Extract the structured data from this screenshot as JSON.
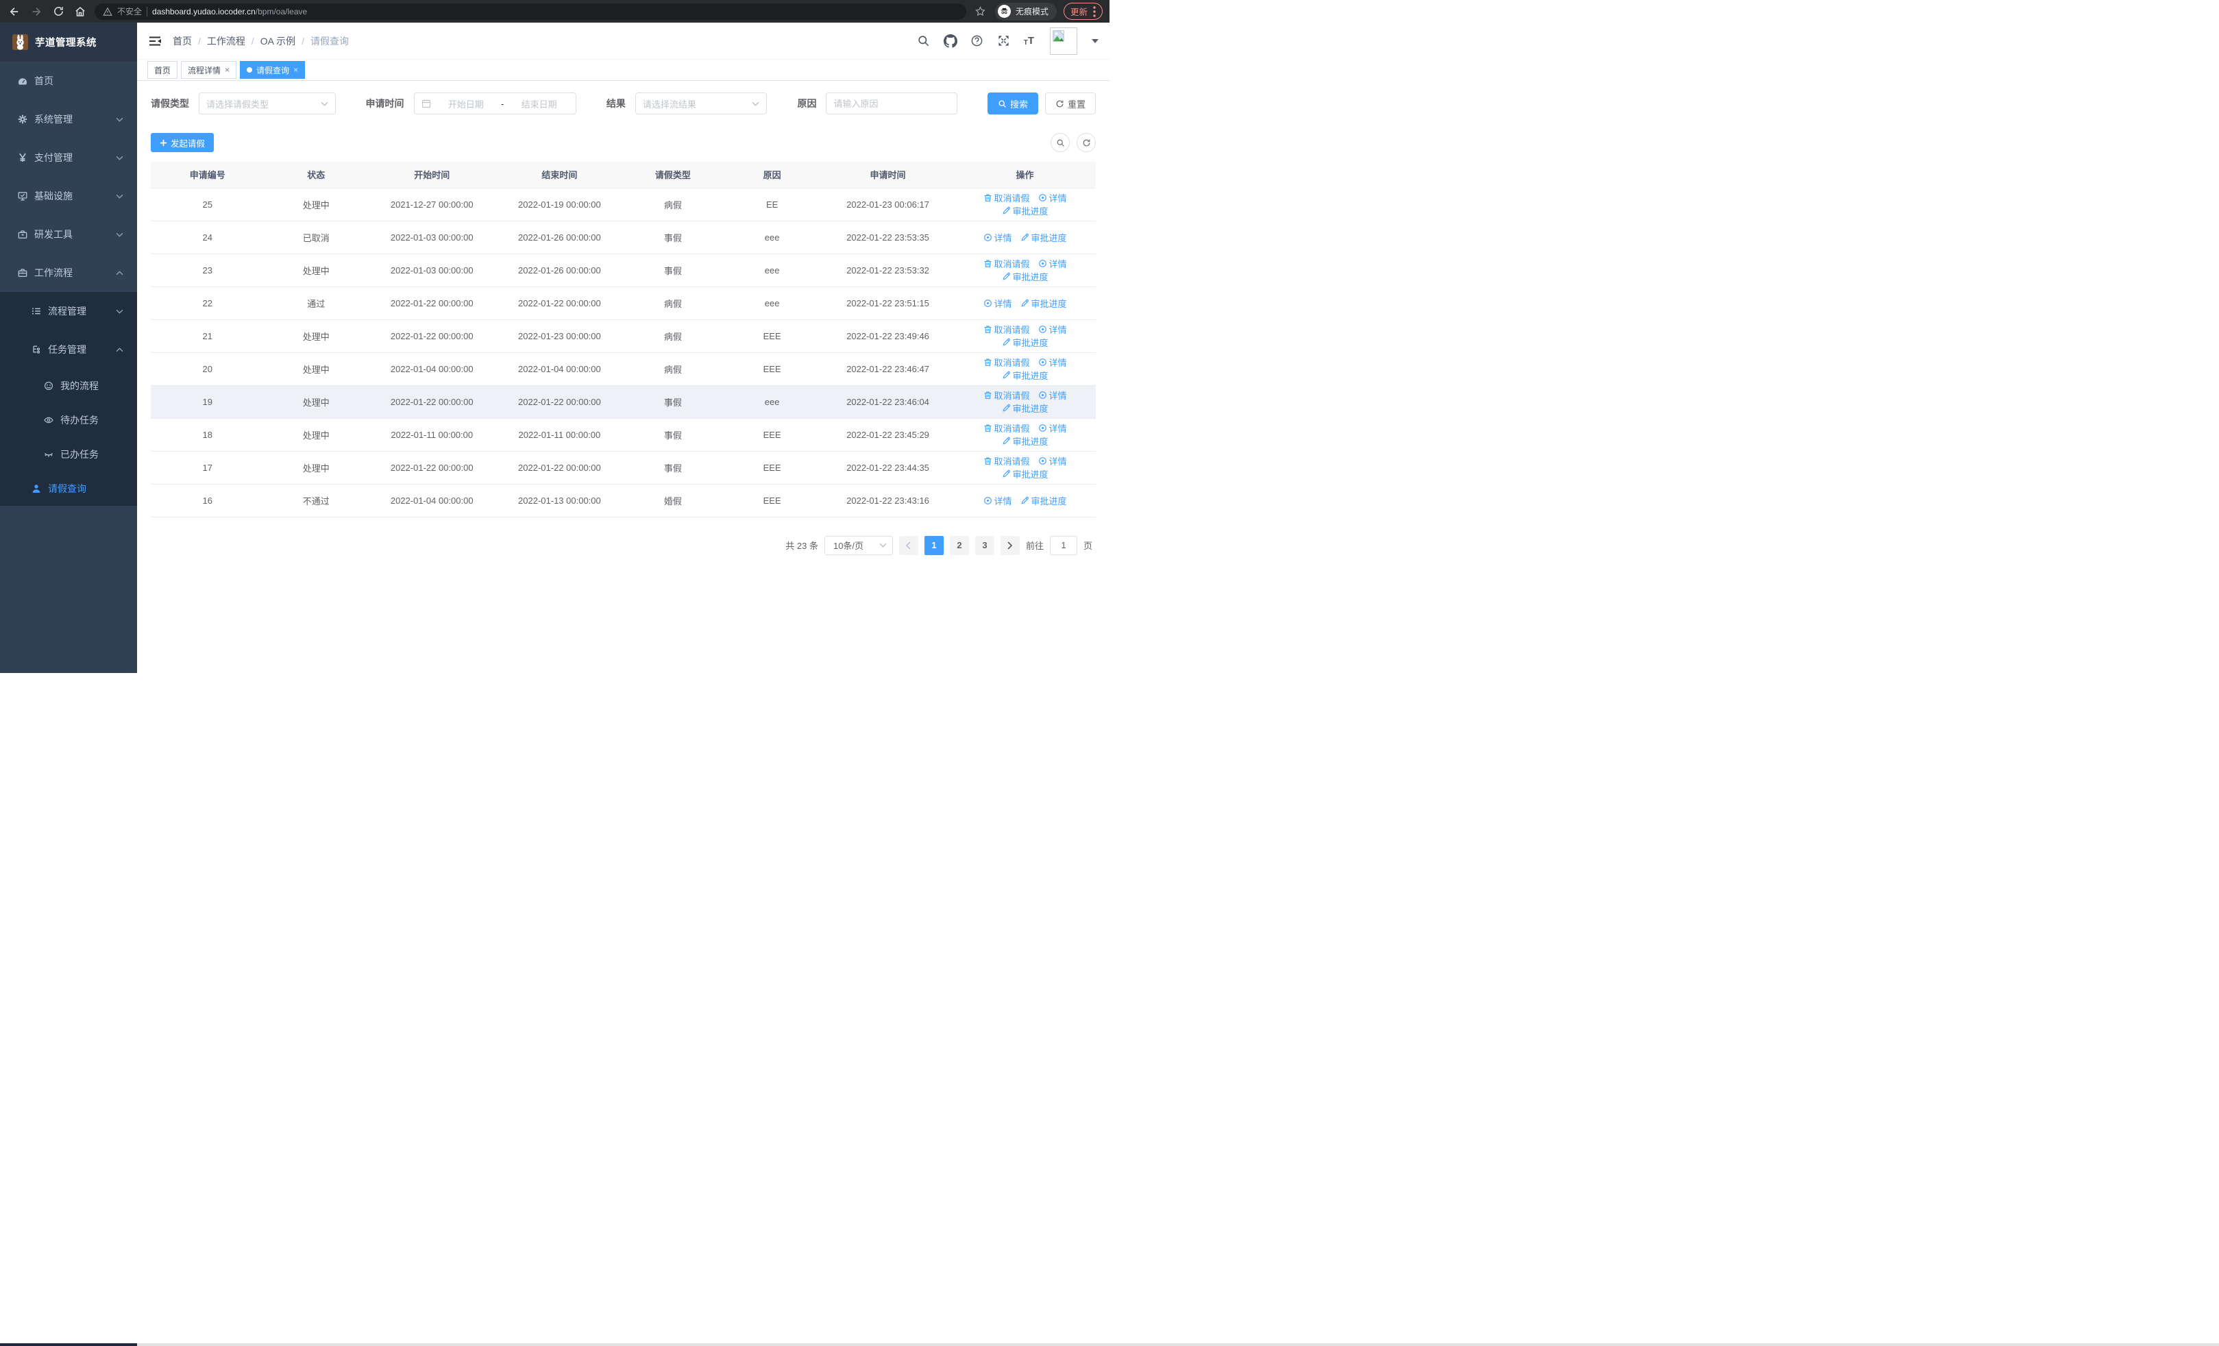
{
  "browser": {
    "security_label": "不安全",
    "url_host": "dashboard.yudao.iocoder.cn",
    "url_path": "/bpm/oa/leave",
    "incognito_label": "无痕模式",
    "update_label": "更新"
  },
  "colors": {
    "primary": "#409eff",
    "sidebar_bg": "#304156",
    "submenu_bg": "#1f2d3d",
    "update_accent": "#f28b82"
  },
  "sidebar": {
    "logo_title": "芋道管理系统",
    "menu": [
      {
        "key": "home",
        "label": "首页",
        "icon": "dashboard-icon",
        "level": 1
      },
      {
        "key": "system",
        "label": "系统管理",
        "icon": "gear-icon",
        "level": 1,
        "arrow": "down"
      },
      {
        "key": "payment",
        "label": "支付管理",
        "icon": "yen-icon",
        "level": 1,
        "arrow": "down"
      },
      {
        "key": "infra",
        "label": "基础设施",
        "icon": "monitor-icon",
        "level": 1,
        "arrow": "down"
      },
      {
        "key": "devtools",
        "label": "研发工具",
        "icon": "toolbox-icon",
        "level": 1,
        "arrow": "down"
      },
      {
        "key": "workflow",
        "label": "工作流程",
        "icon": "briefcase-icon",
        "level": 1,
        "arrow": "up"
      },
      {
        "key": "process-mgmt",
        "label": "流程管理",
        "icon": "list-icon",
        "level": 2,
        "arrow": "down",
        "sub": true
      },
      {
        "key": "task-mgmt",
        "label": "任务管理",
        "icon": "tree-icon",
        "level": 2,
        "arrow": "up",
        "sub": true
      },
      {
        "key": "my-process",
        "label": "我的流程",
        "icon": "face-icon",
        "level": 3,
        "sub": true,
        "leaf": true
      },
      {
        "key": "todo-tasks",
        "label": "待办任务",
        "icon": "eye-open-icon",
        "level": 3,
        "sub": true,
        "leaf": true
      },
      {
        "key": "done-tasks",
        "label": "已办任务",
        "icon": "eye-closed-icon",
        "level": 3,
        "sub": true,
        "leaf": true
      },
      {
        "key": "leave-query",
        "label": "请假查询",
        "icon": "user-icon",
        "level": 2,
        "sub": true,
        "leaf": true,
        "active": true
      }
    ]
  },
  "navbar": {
    "breadcrumbs": [
      "首页",
      "工作流程",
      "OA 示例",
      "请假查询"
    ]
  },
  "tags": [
    {
      "key": "home",
      "label": "首页"
    },
    {
      "key": "process-detail",
      "label": "流程详情",
      "closable": true
    },
    {
      "key": "leave-query",
      "label": "请假查询",
      "closable": true,
      "active": true
    }
  ],
  "filters": {
    "type_label": "请假类型",
    "type_placeholder": "请选择请假类型",
    "time_label": "申请时间",
    "start_placeholder": "开始日期",
    "range_separator": "-",
    "end_placeholder": "结束日期",
    "result_label": "结果",
    "result_placeholder": "请选择流结果",
    "reason_label": "原因",
    "reason_placeholder": "请输入原因",
    "search_label": "搜索",
    "reset_label": "重置"
  },
  "toolbar": {
    "create_label": "发起请假"
  },
  "actions_def": {
    "cancel": {
      "label": "取消请假",
      "icon": "trash-icon"
    },
    "detail": {
      "label": "详情",
      "icon": "view-icon"
    },
    "progress": {
      "label": "审批进度",
      "icon": "edit-icon"
    }
  },
  "table": {
    "columns": [
      "申请编号",
      "状态",
      "开始时间",
      "结束时间",
      "请假类型",
      "原因",
      "申请时间",
      "操作"
    ],
    "rows": [
      {
        "id": "25",
        "status": "处理中",
        "start": "2021-12-27 00:00:00",
        "end": "2022-01-19 00:00:00",
        "type": "病假",
        "reason": "EE",
        "applied": "2022-01-23 00:06:17",
        "actions": [
          "cancel",
          "detail",
          "progress"
        ]
      },
      {
        "id": "24",
        "status": "已取消",
        "start": "2022-01-03 00:00:00",
        "end": "2022-01-26 00:00:00",
        "type": "事假",
        "reason": "eee",
        "applied": "2022-01-22 23:53:35",
        "actions": [
          "detail",
          "progress"
        ]
      },
      {
        "id": "23",
        "status": "处理中",
        "start": "2022-01-03 00:00:00",
        "end": "2022-01-26 00:00:00",
        "type": "事假",
        "reason": "eee",
        "applied": "2022-01-22 23:53:32",
        "actions": [
          "cancel",
          "detail",
          "progress"
        ]
      },
      {
        "id": "22",
        "status": "通过",
        "start": "2022-01-22 00:00:00",
        "end": "2022-01-22 00:00:00",
        "type": "病假",
        "reason": "eee",
        "applied": "2022-01-22 23:51:15",
        "actions": [
          "detail",
          "progress"
        ]
      },
      {
        "id": "21",
        "status": "处理中",
        "start": "2022-01-22 00:00:00",
        "end": "2022-01-23 00:00:00",
        "type": "病假",
        "reason": "EEE",
        "applied": "2022-01-22 23:49:46",
        "actions": [
          "cancel",
          "detail",
          "progress"
        ]
      },
      {
        "id": "20",
        "status": "处理中",
        "start": "2022-01-04 00:00:00",
        "end": "2022-01-04 00:00:00",
        "type": "病假",
        "reason": "EEE",
        "applied": "2022-01-22 23:46:47",
        "actions": [
          "cancel",
          "detail",
          "progress"
        ]
      },
      {
        "id": "19",
        "status": "处理中",
        "start": "2022-01-22 00:00:00",
        "end": "2022-01-22 00:00:00",
        "type": "事假",
        "reason": "eee",
        "applied": "2022-01-22 23:46:04",
        "actions": [
          "cancel",
          "detail",
          "progress"
        ],
        "highlighted": true
      },
      {
        "id": "18",
        "status": "处理中",
        "start": "2022-01-11 00:00:00",
        "end": "2022-01-11 00:00:00",
        "type": "事假",
        "reason": "EEE",
        "applied": "2022-01-22 23:45:29",
        "actions": [
          "cancel",
          "detail",
          "progress"
        ]
      },
      {
        "id": "17",
        "status": "处理中",
        "start": "2022-01-22 00:00:00",
        "end": "2022-01-22 00:00:00",
        "type": "事假",
        "reason": "EEE",
        "applied": "2022-01-22 23:44:35",
        "actions": [
          "cancel",
          "detail",
          "progress"
        ]
      },
      {
        "id": "16",
        "status": "不通过",
        "start": "2022-01-04 00:00:00",
        "end": "2022-01-13 00:00:00",
        "type": "婚假",
        "reason": "EEE",
        "applied": "2022-01-22 23:43:16",
        "actions": [
          "detail",
          "progress"
        ]
      }
    ]
  },
  "pagination": {
    "total_label": "共 23 条",
    "page_size_label": "10条/页",
    "pages": [
      "1",
      "2",
      "3"
    ],
    "active_page": "1",
    "goto_label": "前往",
    "goto_value": "1",
    "goto_suffix": "页"
  }
}
